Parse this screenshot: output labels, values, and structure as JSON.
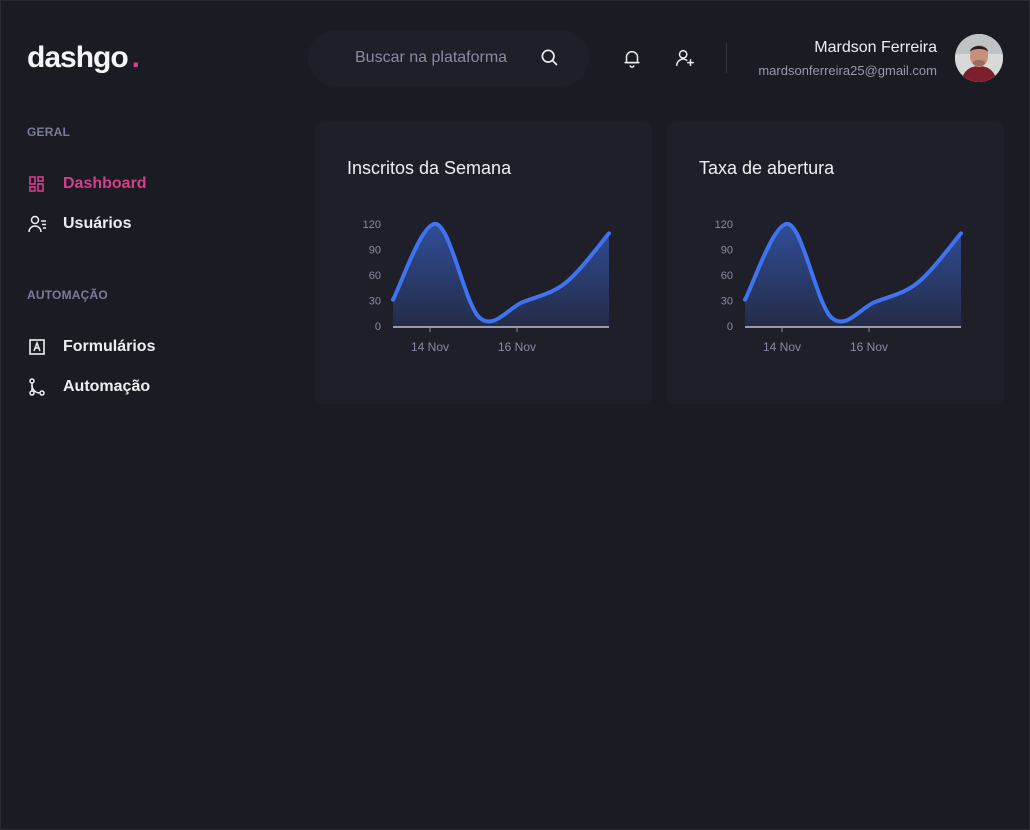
{
  "app": {
    "logo_text": "dashgo",
    "logo_dot": "."
  },
  "header": {
    "search_placeholder": "Buscar na plataforma",
    "user_name": "Mardson Ferreira",
    "user_email": "mardsonferreira25@gmail.com"
  },
  "sidebar": {
    "sections": [
      {
        "title": "GERAL",
        "items": [
          {
            "label": "Dashboard",
            "icon": "dashboard-icon",
            "active": true
          },
          {
            "label": "Usuários",
            "icon": "users-icon",
            "active": false
          }
        ]
      },
      {
        "title": "AUTOMAÇÃO",
        "items": [
          {
            "label": "Formulários",
            "icon": "forms-icon",
            "active": false
          },
          {
            "label": "Automação",
            "icon": "automation-icon",
            "active": false
          }
        ]
      }
    ]
  },
  "colors": {
    "accent": "#d53f8c",
    "series": "#3f73f2",
    "background": "#1b1b23",
    "card": "#1f1f29"
  },
  "chart_data": [
    {
      "type": "area",
      "title": "Inscritos da Semana",
      "x_tick_labels": [
        "14 Nov",
        "16 Nov"
      ],
      "y_ticks": [
        0,
        30,
        60,
        90,
        120
      ],
      "ylim": [
        0,
        120
      ],
      "grid": false,
      "x": [
        0,
        1,
        2,
        3,
        4,
        5,
        6
      ],
      "values": [
        31,
        120,
        10,
        28,
        51,
        109
      ],
      "series": [
        {
          "values": [
            31,
            120,
            10,
            28,
            51,
            109
          ]
        }
      ]
    },
    {
      "type": "area",
      "title": "Taxa de abertura",
      "x_tick_labels": [
        "14 Nov",
        "16 Nov"
      ],
      "y_ticks": [
        0,
        30,
        60,
        90,
        120
      ],
      "ylim": [
        0,
        120
      ],
      "grid": false,
      "values": [
        31,
        120,
        10,
        28,
        51,
        109
      ],
      "series": [
        {
          "values": [
            31,
            120,
            10,
            28,
            51,
            109
          ]
        }
      ]
    }
  ]
}
